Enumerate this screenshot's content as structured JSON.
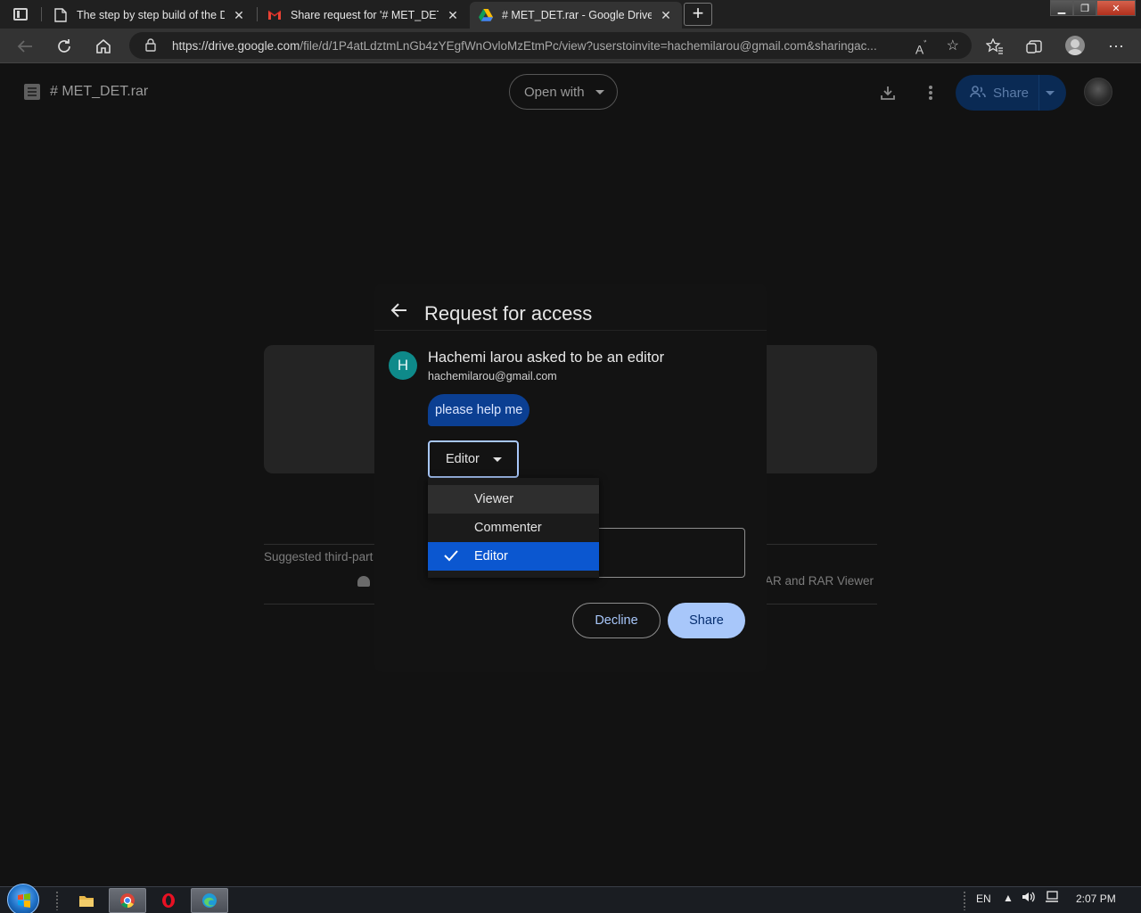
{
  "browser": {
    "tabs": [
      {
        "title": "The step by step build of the Def"
      },
      {
        "title": "Share request for '# MET_DET.rar"
      },
      {
        "title": "# MET_DET.rar - Google Drive"
      }
    ],
    "url_main": "https://drive.google.com",
    "url_rest": "/file/d/1P4atLdztmLnGb4zYEgfWnOvloMzEtmPc/view?userstoinvite=hachemilarou@gmail.com&sharingac..."
  },
  "drive_header": {
    "file_name": "# MET_DET.rar",
    "open_with_label": "Open with",
    "share_label": "Share"
  },
  "background": {
    "suggested_text": "Suggested third-part",
    "app_name_fragment": "AR and RAR Viewer"
  },
  "dialog": {
    "title": "Request for access",
    "requester_initial": "H",
    "requester_line": "Hachemi larou asked to be an editor",
    "requester_email": "hachemilarou@gmail.com",
    "message": "please help me",
    "role_selected": "Editor",
    "role_options": [
      {
        "label": "Viewer"
      },
      {
        "label": "Commenter"
      },
      {
        "label": "Editor"
      }
    ],
    "decline_label": "Decline",
    "share_label": "Share"
  },
  "taskbar": {
    "lang": "EN",
    "time": "2:07 PM"
  },
  "colors": {
    "accent": "#a8c7fa",
    "selected_bg": "#0b57d0",
    "avatar_teal": "#0e8a8a"
  }
}
